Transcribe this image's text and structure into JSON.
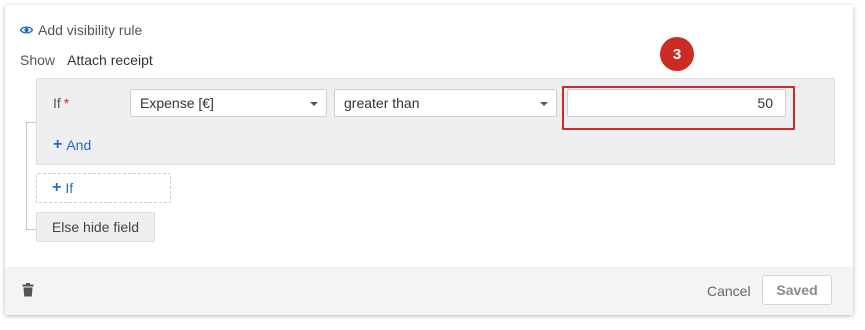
{
  "rule": {
    "add_visibility_label": "Add visibility rule",
    "show_label": "Show",
    "field_name": "Attach receipt"
  },
  "condition": {
    "if_label": "If",
    "required_marker": "*",
    "field_select_value": "Expense [€]",
    "operator_select_value": "greater than",
    "value": "50",
    "add_and_label": "And"
  },
  "add_if_label": "If",
  "else_label": "Else hide field",
  "annotation": {
    "step_number": "3",
    "color": "#cc2b25"
  },
  "footer": {
    "cancel_label": "Cancel",
    "saved_label": "Saved"
  },
  "icons": {
    "eye": "eye-icon",
    "plus": "plus-icon",
    "trash": "trash-icon",
    "caret": "chevron-down-icon"
  },
  "colors": {
    "link": "#1e6ec8",
    "required": "#d0342c",
    "block_bg": "#eeeff1"
  }
}
